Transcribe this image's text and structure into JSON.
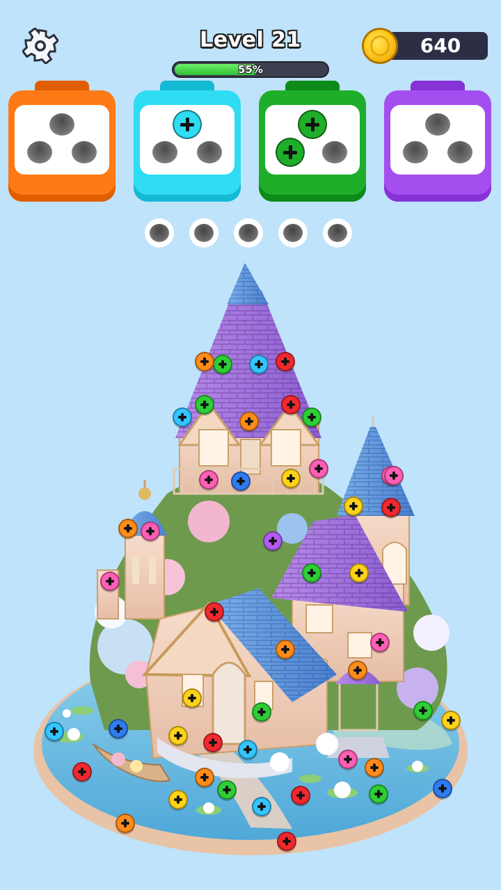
{
  "hud": {
    "level_label": "Level 21",
    "progress_text": "55%",
    "progress_fraction": 0.55,
    "coins": "640",
    "settings_icon": "gear-icon"
  },
  "toolboxes": [
    {
      "name": "orange-toolbox",
      "color": "#ff7a16",
      "dark": "#e05d00",
      "screws": []
    },
    {
      "name": "cyan-toolbox",
      "color": "#2fdcf2",
      "dark": "#14b9d4",
      "screws": [
        "top"
      ]
    },
    {
      "name": "green-toolbox",
      "color": "#1fae2a",
      "dark": "#0d8a18",
      "screws": [
        "top",
        "left"
      ]
    },
    {
      "name": "purple-toolbox",
      "color": "#a54ef0",
      "dark": "#8633d6",
      "screws": []
    }
  ],
  "buffer_slots": 5,
  "screw_colors": {
    "orange": "#ff8c1a",
    "cyan": "#33c5ff",
    "green": "#2ecf35",
    "purple": "#b25cf5",
    "red": "#f0292e",
    "yellow": "#ffd21a",
    "blue": "#2f7cf0",
    "pink": "#ff5fb4",
    "lime": "#7bd84a"
  }
}
